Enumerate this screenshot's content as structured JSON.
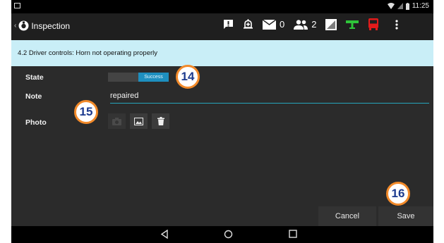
{
  "actionbar": {
    "title": "Inspection",
    "mail_count": "0",
    "people_count": "2"
  },
  "statusbar": {
    "time": "11:25"
  },
  "banner": {
    "text": "4.2 Driver controls: Horn not operating properly"
  },
  "form": {
    "state_label": "State",
    "state_value": "Success",
    "note_label": "Note",
    "note_value": "repaired",
    "photo_label": "Photo"
  },
  "buttons": {
    "cancel": "Cancel",
    "save": "Save"
  },
  "callouts": [
    "14",
    "15",
    "16"
  ],
  "colors": {
    "accent": "#1e8fbf",
    "banner": "#c9eef7",
    "callout_border": "#f28a2a",
    "callout_text": "#1d3b8f"
  }
}
